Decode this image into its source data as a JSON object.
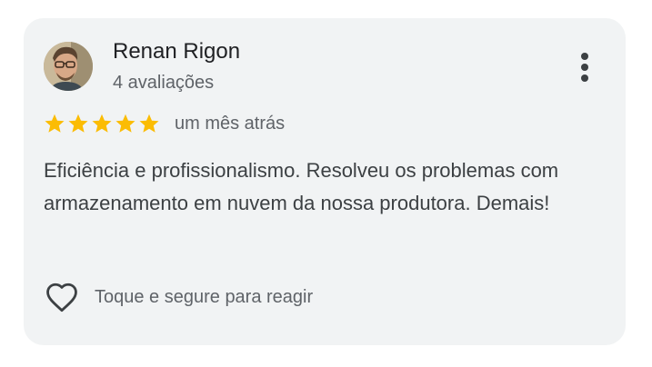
{
  "review": {
    "author_name": "Renan Rigon",
    "author_reviews": "4 avaliações",
    "rating": 5,
    "rating_max": 5,
    "date": "um mês atrás",
    "text": "Eficiência e profissionalismo. Resolveu os problemas com armazenamento em nuvem da nossa produtora. Demais!",
    "react_hint": "Toque e segure para reagir"
  },
  "icons": {
    "more": "more-vert-icon",
    "star": "star-icon",
    "heart": "heart-outline-icon"
  },
  "colors": {
    "card_background": "#f1f3f4",
    "star": "#fbbc04",
    "primary_text": "#202124",
    "secondary_text": "#5f6368"
  }
}
